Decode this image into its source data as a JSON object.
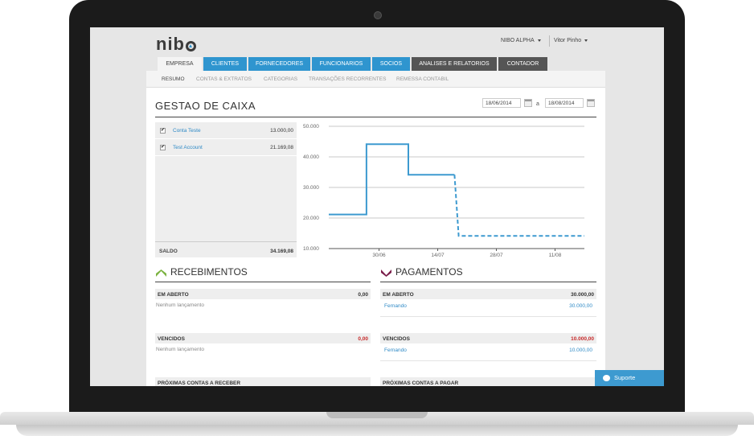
{
  "header": {
    "logo": "nib",
    "company_menu": "NIBO ALPHA",
    "user_menu": "Vitor Pinho"
  },
  "tabs": [
    {
      "label": "EMPRESA",
      "state": "active"
    },
    {
      "label": "CLIENTES",
      "state": "blue"
    },
    {
      "label": "FORNECEDORES",
      "state": "blue"
    },
    {
      "label": "FUNCIONARIOS",
      "state": "blue"
    },
    {
      "label": "SOCIOS",
      "state": "blue"
    },
    {
      "label": "ANALISES E RELATORIOS",
      "state": "dark"
    },
    {
      "label": "CONTADOR",
      "state": "dark"
    }
  ],
  "subnav": [
    "RESUMO",
    "CONTAS & EXTRATOS",
    "CATEGORIAS",
    "TRANSAÇÕES RECORRENTES",
    "REMESSA CONTABIL"
  ],
  "page": {
    "title": "GESTAO DE CAIXA",
    "date_from": "18/06/2014",
    "date_separator": "a",
    "date_to": "18/08/2014"
  },
  "accounts": {
    "items": [
      {
        "name": "Conta Teste",
        "value": "13.000,00",
        "checked": true
      },
      {
        "name": "Test Account",
        "value": "21.169,08",
        "checked": true
      }
    ],
    "saldo_label": "SALDO",
    "saldo_value": "34.169,08"
  },
  "chart_data": {
    "type": "line",
    "y_ticks": [
      "50.000",
      "40.000",
      "30.000",
      "20.000",
      "10.000"
    ],
    "ylim": [
      10000,
      50000
    ],
    "x_ticks": [
      "30/06",
      "14/07",
      "28/07",
      "11/08"
    ],
    "color": "#3d9ad0",
    "series": [
      {
        "style": "solid",
        "points": [
          {
            "x": "18/06",
            "y": 21169
          },
          {
            "x": "27/06",
            "y": 21169
          },
          {
            "x": "27/06",
            "y": 44169
          },
          {
            "x": "07/07",
            "y": 44169
          },
          {
            "x": "07/07",
            "y": 34169
          },
          {
            "x": "18/07",
            "y": 34169
          }
        ]
      },
      {
        "style": "dashed",
        "points": [
          {
            "x": "18/07",
            "y": 34169
          },
          {
            "x": "19/07",
            "y": 14169
          },
          {
            "x": "18/08",
            "y": 14169
          }
        ]
      }
    ]
  },
  "recebimentos": {
    "title": "RECEBIMENTOS",
    "em_aberto_label": "EM ABERTO",
    "em_aberto_value": "0,00",
    "em_aberto_note": "Nenhum lançamento",
    "vencidos_label": "VENCIDOS",
    "vencidos_value": "0,00",
    "vencidos_note": "Nenhum lançamento",
    "proximas_label": "PRÓXIMAS CONTAS A RECEBER",
    "color": "#7cb342"
  },
  "pagamentos": {
    "title": "PAGAMENTOS",
    "em_aberto_label": "EM ABERTO",
    "em_aberto_value": "30.000,00",
    "em_aberto_item": {
      "name": "Fernando",
      "value": "30.000,00"
    },
    "vencidos_label": "VENCIDOS",
    "vencidos_value": "10.000,00",
    "vencidos_item": {
      "name": "Fernando",
      "value": "10.000,00"
    },
    "proximas_label": "PRÓXIMAS CONTAS A PAGAR",
    "color": "#7b1f4b"
  },
  "support": {
    "label": "Suporte"
  }
}
